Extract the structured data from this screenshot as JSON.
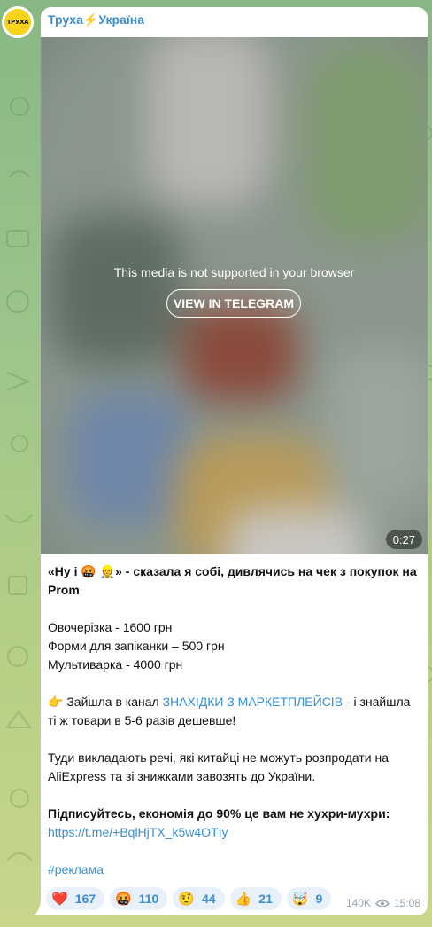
{
  "channel": {
    "name": "Труха⚡Україна",
    "avatar_text": "ТРУХА"
  },
  "media": {
    "unsupported_message": "This media is not supported in your browser",
    "view_button": "VIEW IN TELEGRAM",
    "duration": "0:27"
  },
  "post": {
    "line1": "«Ну і 🤬 👷» - сказала я собі, дивлячись на чек з покупок на Prom",
    "item1": "Овочерізка - 1600 грн",
    "item2": "Форми для запіканки – 500 грн",
    "item3": "Мультиварка - 4000 грн",
    "para2_prefix": "👉 Зайшла в канал ",
    "para2_link": "ЗНАХІДКИ З МАРКЕТПЛЕЙСІВ",
    "para2_suffix": " - і знайшла ті ж товари в 5-6 разів дешевше!",
    "para3": "Туди викладають речі, які китайці не можуть розпродати на AliExpress та зі знижками завозять до України.",
    "para4": "Підписуйтесь, економія до 90% це вам не хухри-мухри:",
    "subscribe_link": "https://t.me/+BqlHjTX_k5w4OTIy",
    "hashtag": "#реклама"
  },
  "reactions": [
    {
      "emoji": "❤️",
      "count": "167"
    },
    {
      "emoji": "🤬",
      "count": "110"
    },
    {
      "emoji": "🤨",
      "count": "44"
    },
    {
      "emoji": "👍",
      "count": "21"
    },
    {
      "emoji": "🤯",
      "count": "9"
    }
  ],
  "meta": {
    "views": "140K",
    "time": "15:08"
  },
  "colors": {
    "accent": "#3a8fd0",
    "bubble": "#ffffff",
    "reaction_bg": "#e8f1fa"
  }
}
